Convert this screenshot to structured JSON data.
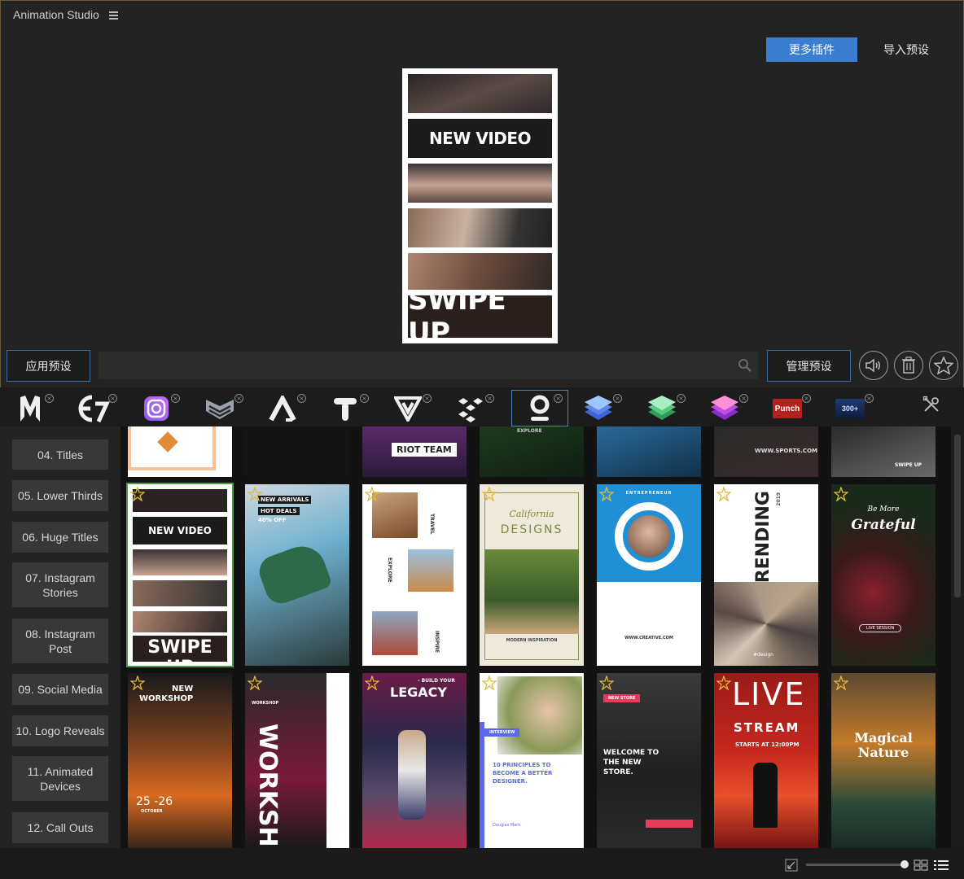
{
  "app": {
    "title": "Animation Studio",
    "menu_icon": "hamburger-menu-icon"
  },
  "header": {
    "more_plugins_label": "更多插件",
    "import_preset_label": "导入预设",
    "accent": "#3b7ed1"
  },
  "preview": {
    "line1": "NEW VIDEO",
    "line2": "SWIPE UP"
  },
  "toolbar": {
    "apply_label": "应用预设",
    "manage_label": "管理预设",
    "search_value": "",
    "search_placeholder": "",
    "icons": [
      "volume-icon",
      "trash-icon",
      "star-icon"
    ]
  },
  "plugins": [
    {
      "name": "m-logo-icon",
      "text": "M"
    },
    {
      "name": "e7-logo-icon",
      "text": "E7"
    },
    {
      "name": "instagram-logo-icon",
      "text": ""
    },
    {
      "name": "chevron-shield-icon",
      "text": ""
    },
    {
      "name": "a-logo-icon",
      "text": "A"
    },
    {
      "name": "t-logo-icon",
      "text": "T"
    },
    {
      "name": "v-logo-icon",
      "text": "V"
    },
    {
      "name": "molecule-icon",
      "text": ""
    },
    {
      "name": "q-logo-icon",
      "text": ""
    },
    {
      "name": "blue-layers-icon",
      "text": ""
    },
    {
      "name": "green-layers-icon",
      "text": ""
    },
    {
      "name": "pink-layers-icon",
      "text": ""
    },
    {
      "name": "punch-logo-icon",
      "text": "Punch"
    },
    {
      "name": "badge-300-icon",
      "text": "300+"
    }
  ],
  "categories": [
    {
      "label": "04. Titles"
    },
    {
      "label": "05. Lower Thirds"
    },
    {
      "label": "06. Huge Titles"
    },
    {
      "label": "07. Instagram Stories"
    },
    {
      "label": "08. Instagram Post"
    },
    {
      "label": "09. Social Media"
    },
    {
      "label": "10. Logo Reveals"
    },
    {
      "label": "11. Animated Devices"
    },
    {
      "label": "12. Call Outs"
    }
  ],
  "tiles_top": [
    {
      "text": ""
    },
    {
      "text": ""
    },
    {
      "text": "RIOT TEAM"
    },
    {
      "text": "EXPLORE"
    },
    {
      "text": ""
    },
    {
      "text": "WWW.SPORTS.COM"
    },
    {
      "text": "SWIPE UP"
    }
  ],
  "tiles_row1": [
    {
      "t1": "NEW VIDEO",
      "t2": "SWIPE UP",
      "bg": "#1b1b1b"
    },
    {
      "t1": "NEW ARRIVALS",
      "t2": "HOT DEALS",
      "t3": "40% OFF",
      "bg": "#6fb0cf"
    },
    {
      "t1": "TRAVEL",
      "t2": "EXPLORE",
      "t3": "INSPIRE",
      "bg": "#ffffff"
    },
    {
      "t1": "California",
      "t2": "DESIGNS",
      "t3": "MODERN INSPIRATION",
      "bg": "#efe9dc"
    },
    {
      "t1": "ENTREPRENEUR",
      "t2": "WWW.CREATIVE.COM",
      "bg": "#1f8fd6"
    },
    {
      "t1": "TRENDING",
      "t2": "2019",
      "t3": "#design",
      "bg": "#ffffff"
    },
    {
      "t1": "Be More",
      "t2": "Grateful",
      "t3": "LIVE SESSION",
      "bg": "#20281f"
    }
  ],
  "tiles_row2": [
    {
      "t1": "NEW",
      "t2": "WORKSHOP",
      "t3": "25 -26",
      "t4": "OCTOBER",
      "bg": "#3a2418"
    },
    {
      "t1": "WORKSHOP",
      "t2": "WORKSH",
      "bg": "#1a1a1a"
    },
    {
      "t1": "- BUILD YOUR",
      "t2": "LEGACY",
      "bg": "#6a1c48"
    },
    {
      "t1": "INTERVIEW",
      "t2": "10 PRINCIPLES TO BECOME A BETTER DESIGNER.",
      "t3": "Douglas Mark",
      "bg": "#ffffff"
    },
    {
      "t1": "NEW STORE",
      "t2": "WELCOME TO THE NEW STORE.",
      "bg": "#2b2b2b"
    },
    {
      "t1": "LIVE",
      "t2": "STREAM",
      "t3": "STARTS AT 12:00PM",
      "bg": "#b6201d"
    },
    {
      "t1": "Magical",
      "t2": "Nature",
      "bg": "#5d4a32"
    }
  ]
}
